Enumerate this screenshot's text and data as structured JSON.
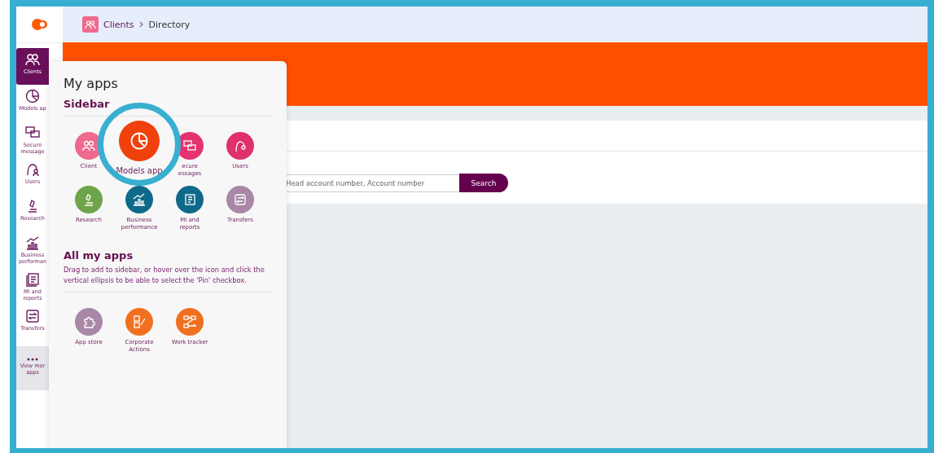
{
  "breadcrumb": {
    "section": "Clients",
    "page": "Directory"
  },
  "sidebar": {
    "items": [
      {
        "label": "Clients",
        "selected": true,
        "kind": "app"
      },
      {
        "label": "Models ap",
        "selected": false,
        "kind": "app"
      },
      {
        "label": "Secure message",
        "selected": false,
        "kind": "app"
      },
      {
        "label": "Users",
        "selected": false,
        "kind": "app"
      },
      {
        "label": "Research",
        "selected": false,
        "kind": "app"
      },
      {
        "label": "Business performan",
        "selected": false,
        "kind": "app"
      },
      {
        "label": "MI and reports",
        "selected": false,
        "kind": "app"
      },
      {
        "label": "Transfers",
        "selected": false,
        "kind": "app"
      },
      {
        "label": "View mor apps",
        "selected": false,
        "kind": "more"
      }
    ]
  },
  "search": {
    "placeholder": "Head account number, Account number",
    "button": "Search"
  },
  "my_apps": {
    "title": "My apps",
    "sidebar_section": {
      "title": "Sidebar",
      "apps": [
        {
          "label": "Client",
          "color": "#ee6a8e",
          "highlighted": false
        },
        {
          "label": "Models app",
          "color": "#f0400c",
          "highlighted": true
        },
        {
          "label": "ecure essages",
          "color": "#e5336f",
          "highlighted": false
        },
        {
          "label": "Users",
          "color": "#e0306e",
          "highlighted": false
        },
        {
          "label": "Research",
          "color": "#6ea449",
          "highlighted": false
        },
        {
          "label": "Business performance",
          "color": "#0f6a89",
          "highlighted": false
        },
        {
          "label": "MI and reports",
          "color": "#0f6a89",
          "highlighted": false
        },
        {
          "label": "Transfers",
          "color": "#a887a7",
          "highlighted": false
        }
      ]
    },
    "all_section": {
      "title": "All my apps",
      "description": "Drag to add to sidebar, or hover over the icon and click the vertical ellipsis to be able to select the 'Pin' checkbox.",
      "apps": [
        {
          "label": "App store",
          "color": "#a887a7",
          "highlighted": false
        },
        {
          "label": "Corporate Actions",
          "color": "#f07020",
          "highlighted": false
        },
        {
          "label": "Work tracker",
          "color": "#f07020",
          "highlighted": false
        }
      ]
    }
  }
}
